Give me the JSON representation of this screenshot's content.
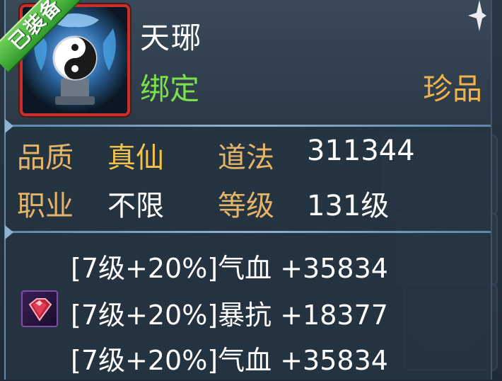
{
  "item": {
    "equipped_badge": "已装备",
    "name": "天琊",
    "bind_status": "绑定",
    "rarity": "珍品",
    "icon": "yinyang-pedestal-icon"
  },
  "stats": {
    "quality_label": "品质",
    "quality_value": "真仙",
    "dao_label": "道法",
    "dao_value": "311344",
    "class_label": "职业",
    "class_value": "不限",
    "level_label": "等级",
    "level_value": "131级"
  },
  "gems": {
    "icon": "red-gem-icon",
    "rows": [
      "[7级+20%]气血 +35834",
      "[7级+20%]暴抗 +18377",
      "[7级+20%]气血 +35834"
    ]
  },
  "colors": {
    "name": "#ffffff",
    "bind": "#7be04a",
    "rarity": "#f0b24a",
    "label": "#e6b468",
    "quality": "#f3c24b",
    "frame": "#c9302c"
  }
}
